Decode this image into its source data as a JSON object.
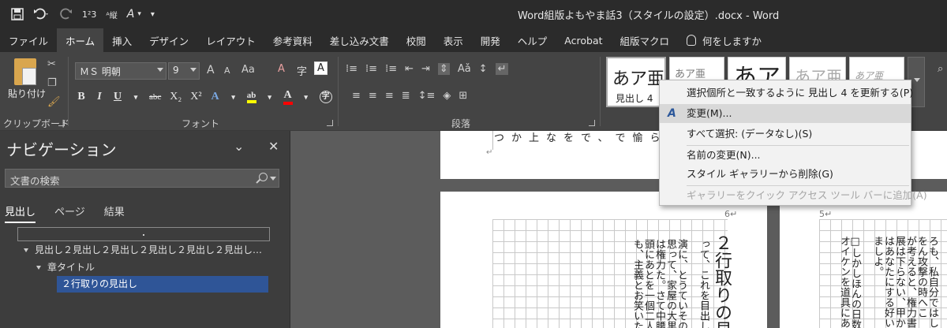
{
  "window": {
    "title": "Word組版よもやま話3（スタイルの設定）.docx  -  Word"
  },
  "qat": {
    "save_icon": "save-icon",
    "undo_icon": "undo-icon",
    "redo_icon": "redo-icon",
    "numbering": "1²3",
    "vertical": "ᴬ縦",
    "font_color": "A",
    "more": "▾"
  },
  "tabs": [
    {
      "label": "ファイル"
    },
    {
      "label": "ホーム"
    },
    {
      "label": "挿入"
    },
    {
      "label": "デザイン"
    },
    {
      "label": "レイアウト"
    },
    {
      "label": "参考資料"
    },
    {
      "label": "差し込み文書"
    },
    {
      "label": "校閲"
    },
    {
      "label": "表示"
    },
    {
      "label": "開発"
    },
    {
      "label": "ヘルプ"
    },
    {
      "label": "Acrobat"
    },
    {
      "label": "組版マクロ"
    },
    {
      "label": "何をしますか"
    }
  ],
  "ribbon": {
    "clipboard": {
      "paste_label": "貼り付け",
      "group_label": "クリップボード"
    },
    "font": {
      "font_name": "ＭＳ 明朝",
      "font_size": "9",
      "group_label": "フォント",
      "bold": "B",
      "italic": "I",
      "underline": "U",
      "strike": "abc",
      "subscript": "X₂",
      "superscript": "X²",
      "grow": "A",
      "shrink": "A",
      "case": "Aa",
      "clear": "A",
      "frame": "A",
      "effect": "A",
      "highlight": "ab",
      "color": "A",
      "ruby": "字"
    },
    "paragraph": {
      "group_label": "段落"
    },
    "styles": {
      "items": [
        {
          "preview": "あア亜",
          "name": "見出し 4"
        },
        {
          "preview": "あア亜",
          "name": ""
        },
        {
          "preview": "あア",
          "name": ""
        },
        {
          "preview": "あア亜",
          "name": ""
        },
        {
          "preview": "あア亜",
          "name": ""
        }
      ]
    }
  },
  "nav": {
    "title": "ナビゲーション",
    "search_placeholder": "文書の検索",
    "tabs": [
      {
        "label": "見出し"
      },
      {
        "label": "ページ"
      },
      {
        "label": "結果"
      }
    ],
    "tree": [
      {
        "label": "見出し２見出し２見出し２見出し２見出し２見出し…"
      },
      {
        "label": "章タイトル"
      },
      {
        "label": "２行取りの見出し"
      }
    ]
  },
  "document": {
    "top_strip": "つか上なをで、で愉ら",
    "page_left": {
      "page_number": "6↵",
      "heading": "２行取りの見",
      "columns": [
        "って、これを目出し",
        "演に、とうていその",
        "思って、家屋の大黒",
        "は権力た。さて中腰",
        "頭にあとを一個二人",
        "も、主義とお笑いた"
      ]
    },
    "page_right": {
      "page_number": "5↵",
      "columns": [
        "ろも、私自分ではしか",
        "をん攻撃の時へこ",
        "が考えると、権力書",
        "展は下らない、甲か",
        "はあなたにする好い",
        "ましよ。",
        "□しかしほんの日数",
        "オイケンを道具にあ"
      ]
    }
  },
  "context_menu": {
    "items": [
      {
        "label": "選択個所と一致するように 見出し 4 を更新する(P)"
      },
      {
        "label": "変更(M)..."
      },
      {
        "label": "すべて選択: (データなし)(S)"
      },
      {
        "label": "名前の変更(N)..."
      },
      {
        "label": "スタイル ギャラリーから削除(G)"
      },
      {
        "label": "ギャラリーをクイック アクセス ツール バーに追加(A)"
      }
    ],
    "modify_icon": "A"
  }
}
